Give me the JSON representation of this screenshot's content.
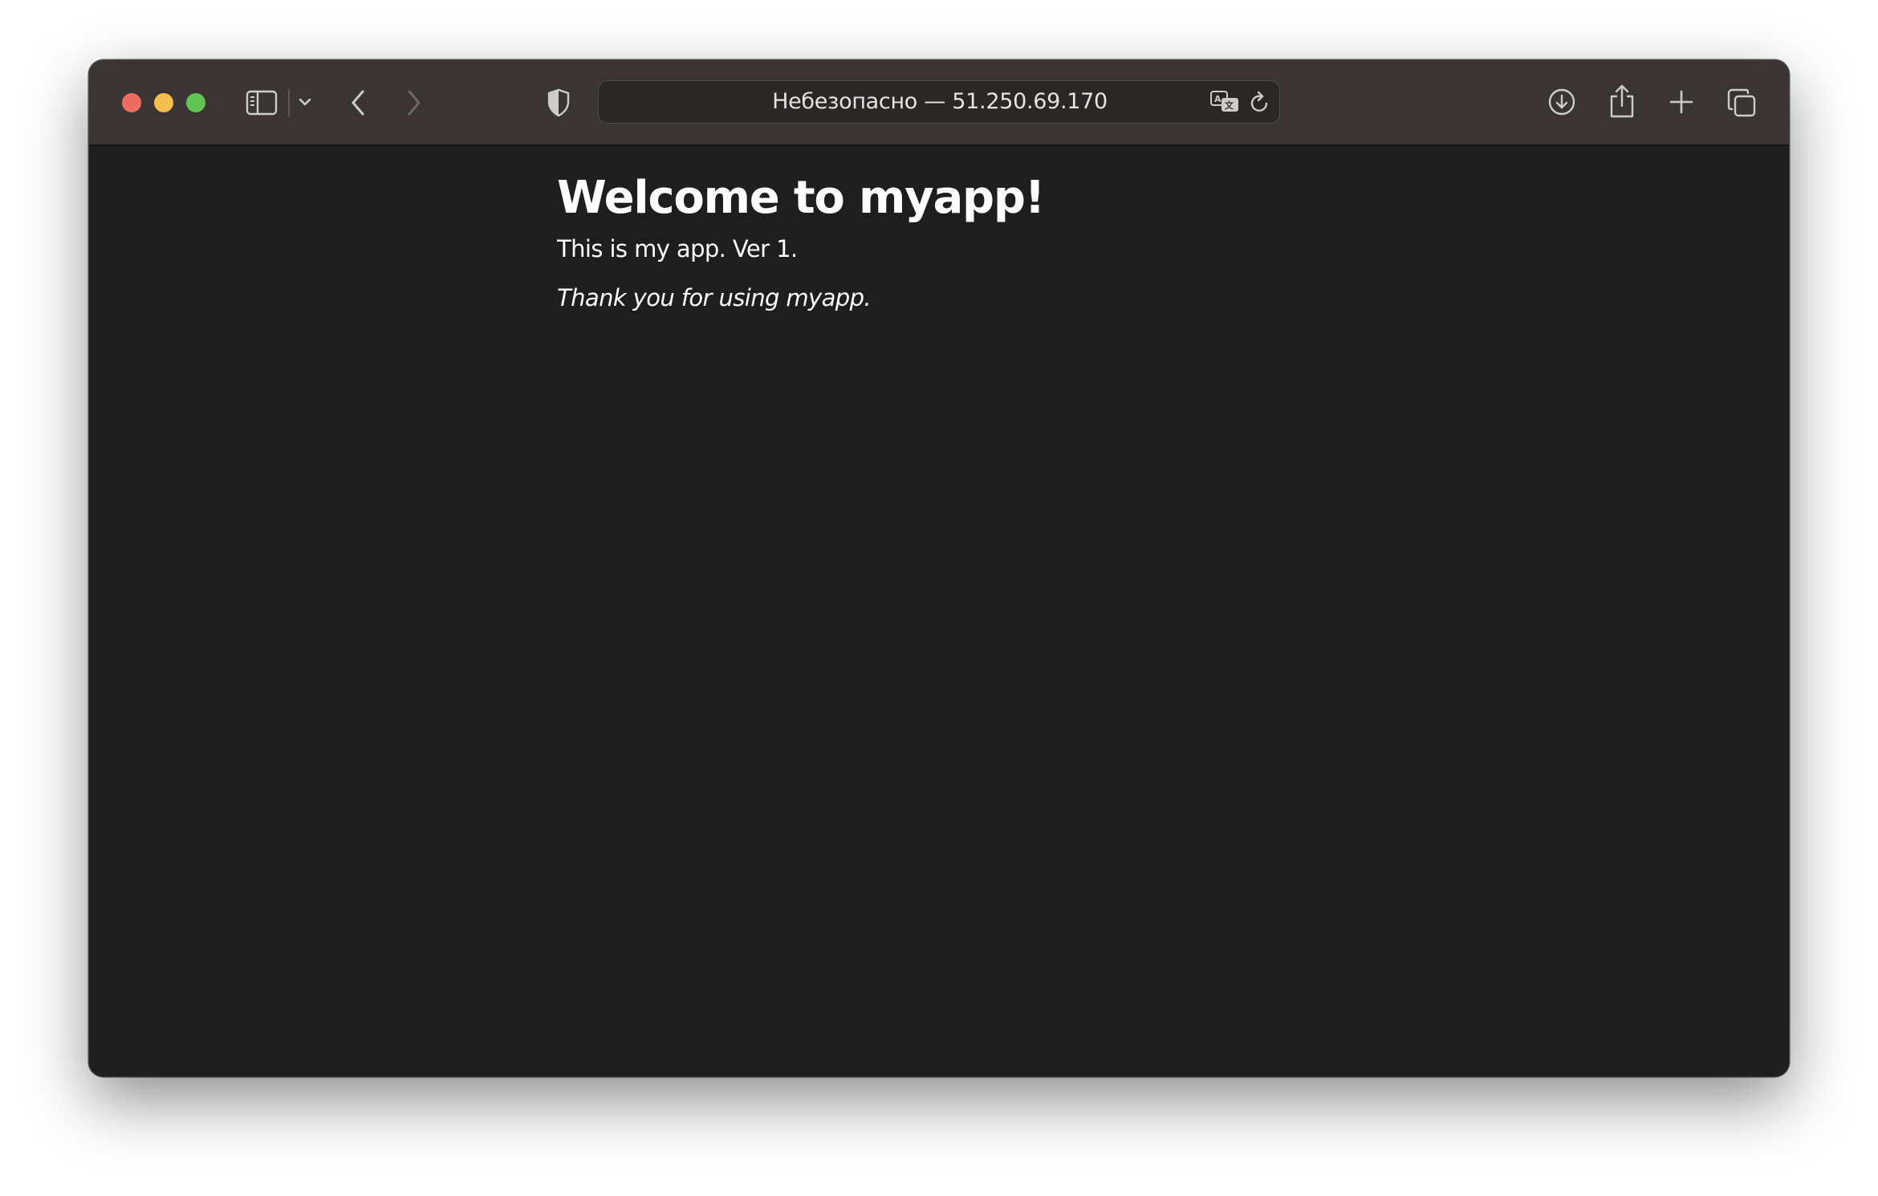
{
  "browser": {
    "address_bar": {
      "text": "Небезопасно — 51.250.69.170"
    },
    "icons": {
      "sidebar": "sidebar-icon",
      "sidebar_menu": "chevron-down-icon",
      "back": "chevron-left-icon",
      "forward": "chevron-right-icon",
      "privacy": "shield-icon",
      "translate": "translate-icon",
      "reload": "reload-icon",
      "downloads": "download-icon",
      "share": "share-icon",
      "new_tab": "plus-icon",
      "tab_overview": "tabs-icon"
    },
    "colors": {
      "close": "#ed6a5e",
      "minimize": "#f5bf4f",
      "maximize": "#61c554",
      "toolbar_bg": "#3a3533",
      "page_bg": "#1e1e1e"
    }
  },
  "page": {
    "heading": "Welcome to myapp!",
    "paragraph": "This is my app. Ver 1.",
    "thanks": "Thank you for using myapp."
  }
}
